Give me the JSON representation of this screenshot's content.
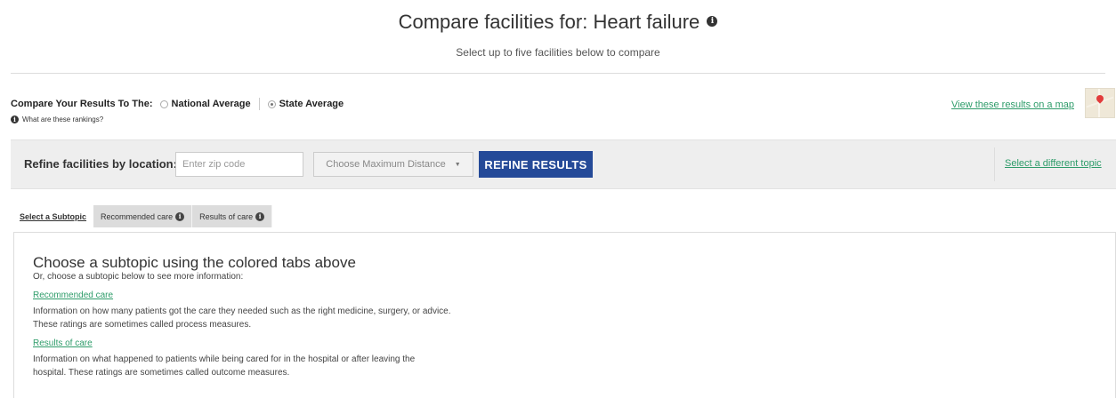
{
  "header": {
    "title": "Compare facilities for: Heart failure",
    "subtitle": "Select up to five facilities below to compare"
  },
  "compare": {
    "label": "Compare Your Results To The:",
    "options": [
      {
        "label": "National Average",
        "selected": false
      },
      {
        "label": "State Average",
        "selected": true
      }
    ],
    "help_text": "What are these rankings?"
  },
  "map": {
    "link_text": "View these results on a map",
    "thumbnail_icon": "map-pin-icon"
  },
  "refine": {
    "label": "Refine facilities by location:",
    "zip_placeholder": "Enter zip code",
    "zip_value": "",
    "distance_selected": "Choose Maximum Distance",
    "button_label": "REFINE RESULTS",
    "topic_link": "Select a different topic"
  },
  "subtopics": {
    "label": "Select a Subtopic",
    "tabs": [
      {
        "label": "Recommended care"
      },
      {
        "label": "Results of care"
      }
    ]
  },
  "content": {
    "heading": "Choose a subtopic using the colored tabs above",
    "subheading": "Or, choose a subtopic below to see more information:",
    "items": [
      {
        "link": "Recommended care",
        "line1": "Information on how many patients got the care they needed such as the right medicine, surgery, or advice.",
        "line2": "These ratings are sometimes called process measures."
      },
      {
        "link": "Results of care",
        "line1": "Information on what happened to patients while being cared for in the hospital or after leaving the",
        "line2": "hospital. These ratings are sometimes called outcome measures."
      }
    ]
  },
  "colors": {
    "accent_button": "#254a98",
    "link": "#2e9c6a",
    "bar_background": "#eeeeee",
    "tab_background": "#dcdcdc"
  }
}
